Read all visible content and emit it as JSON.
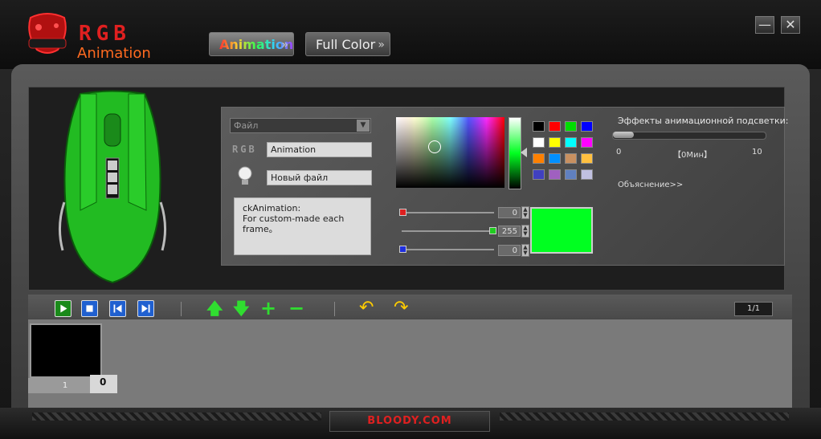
{
  "header": {
    "rgb_title": "RGB",
    "app_title": "Animation",
    "tabs": [
      {
        "label": "Animation",
        "active": true
      },
      {
        "label": "Full Color",
        "active": false
      }
    ],
    "minimize_label": "—",
    "close_label": "✕"
  },
  "editor": {
    "file_select": "Файл",
    "rgb_label": "RGB",
    "name_value": "Animation",
    "file_value": "Новый файл",
    "description_line1": "ckAnimation:",
    "description_line2": "For custom-made each frame。"
  },
  "color": {
    "red_value": "0",
    "green_value": "255",
    "blue_value": "0",
    "current": "#00ff20",
    "swatches": [
      "#000000",
      "#ff0000",
      "#00dd00",
      "#0000ff",
      "#ffffff",
      "#ffff00",
      "#00ffff",
      "#ff00ff",
      "#ff8000",
      "#0090ff",
      "#c89060",
      "#ffc040",
      "#4040c0",
      "#a060c0",
      "#6080c0",
      "#c0c0e0"
    ]
  },
  "effects": {
    "title": "Эффекты анимационной подсветки:",
    "min_label": "0",
    "mid_label": "【0Мин】",
    "max_label": "10",
    "explain_link": "Объяснение>>"
  },
  "toolbar": {
    "page_indicator": "1/1"
  },
  "timeline": {
    "frame_number": "1",
    "frame_delay": "0"
  },
  "footer": {
    "brand": "BLOODY.COM"
  }
}
